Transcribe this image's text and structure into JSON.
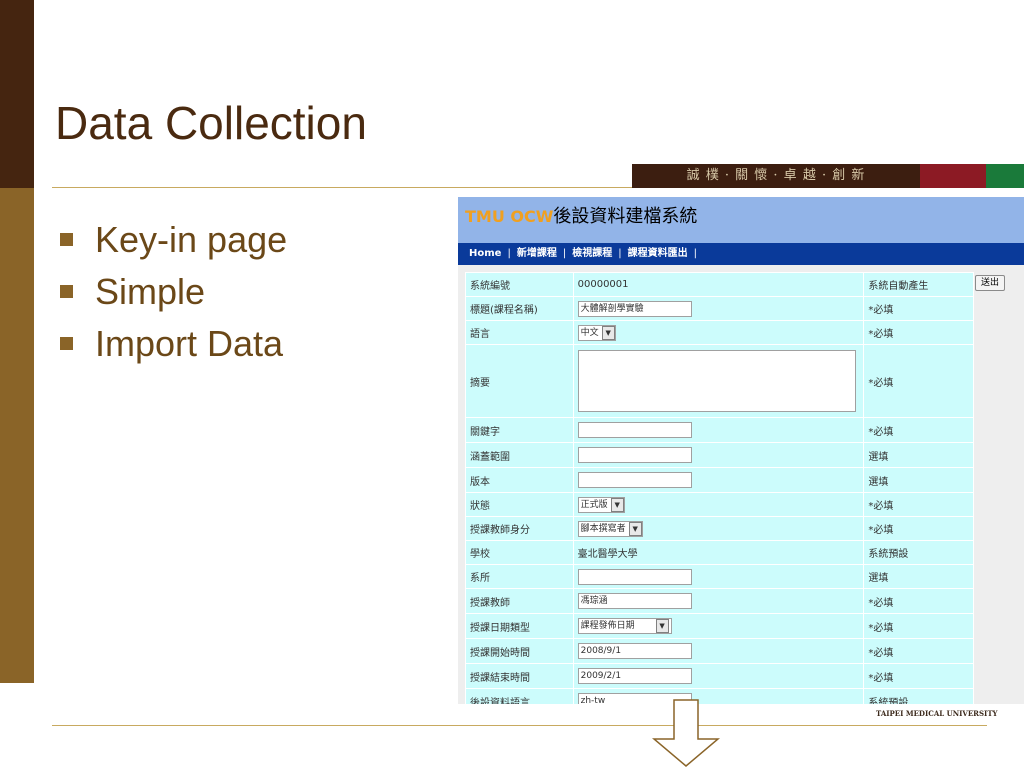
{
  "slide": {
    "title": "Data Collection",
    "bullets": [
      "Key-in page",
      "Simple",
      "Import Data"
    ],
    "motto": "誠 樸 · 關 懷 · 卓 越 · 創 新",
    "university": "TAIPEI MEDICAL UNIVERSITY"
  },
  "app": {
    "title_brand": "TMU OCW",
    "title_text": "後設資料建檔系統",
    "nav": [
      "Home",
      "新增課程",
      "檢視課程",
      "課程資料匯出"
    ],
    "nav_sep": "|",
    "submit_label": "送出"
  },
  "form": {
    "rows": [
      {
        "label": "系統編號",
        "value": "00000001",
        "note": "系統自動產生"
      },
      {
        "label": "標題(課程名稱)",
        "value": "大體解剖學實驗",
        "note": "*必填"
      },
      {
        "label": "語言",
        "value": "中文",
        "note": "*必填"
      },
      {
        "label": "摘要",
        "value": "",
        "note": "*必填"
      },
      {
        "label": "關鍵字",
        "value": "",
        "note": "*必填"
      },
      {
        "label": "涵蓋範圍",
        "value": "",
        "note": "選填"
      },
      {
        "label": "版本",
        "value": "",
        "note": "選填"
      },
      {
        "label": "狀態",
        "value": "正式版",
        "note": "*必填"
      },
      {
        "label": "授課教師身分",
        "value": "腳本撰寫者",
        "note": "*必填"
      },
      {
        "label": "學校",
        "value": "臺北醫學大學",
        "note": "系統預設"
      },
      {
        "label": "系所",
        "value": "",
        "note": "選填"
      },
      {
        "label": "授課教師",
        "value": "馮琮涵",
        "note": "*必填"
      },
      {
        "label": "授課日期類型",
        "value": "課程發佈日期",
        "note": "*必填"
      },
      {
        "label": "授課開始時間",
        "value": "2008/9/1",
        "note": "*必填"
      },
      {
        "label": "授課結束時間",
        "value": "2009/2/1",
        "note": "*必填"
      },
      {
        "label": "後設資料語言",
        "value": "zh-tw",
        "note": "系統預設"
      }
    ]
  },
  "colors": {
    "sidebar_dark": "#452510",
    "sidebar_gold": "#8a6428",
    "title": "#4a2a10",
    "app_header": "#92b4e8",
    "app_nav": "#0a3a9a",
    "form_cell": "#ccfcfc",
    "motto_red": "#8c1a24",
    "motto_green": "#1a7a3a"
  }
}
